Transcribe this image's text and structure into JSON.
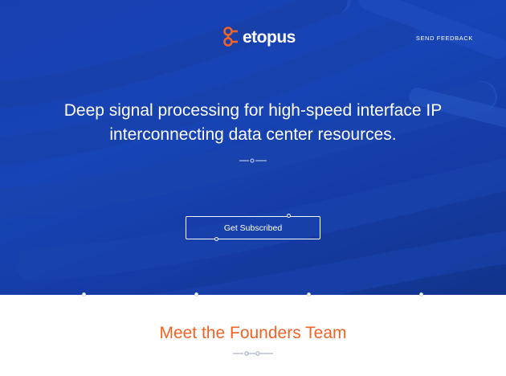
{
  "header": {
    "logo_text": "etopus",
    "feedback_label": "SEND FEEDBACK"
  },
  "hero": {
    "headline_line1": "Deep signal processing for high-speed interface IP",
    "headline_line2": "interconnecting data center resources.",
    "cta_label": "Get Subscribed"
  },
  "founders": {
    "title": "Meet the Founders Team"
  },
  "colors": {
    "hero_blue": "#1846b8",
    "accent_orange": "#f06326",
    "divider_gray": "#9aa3b5"
  }
}
